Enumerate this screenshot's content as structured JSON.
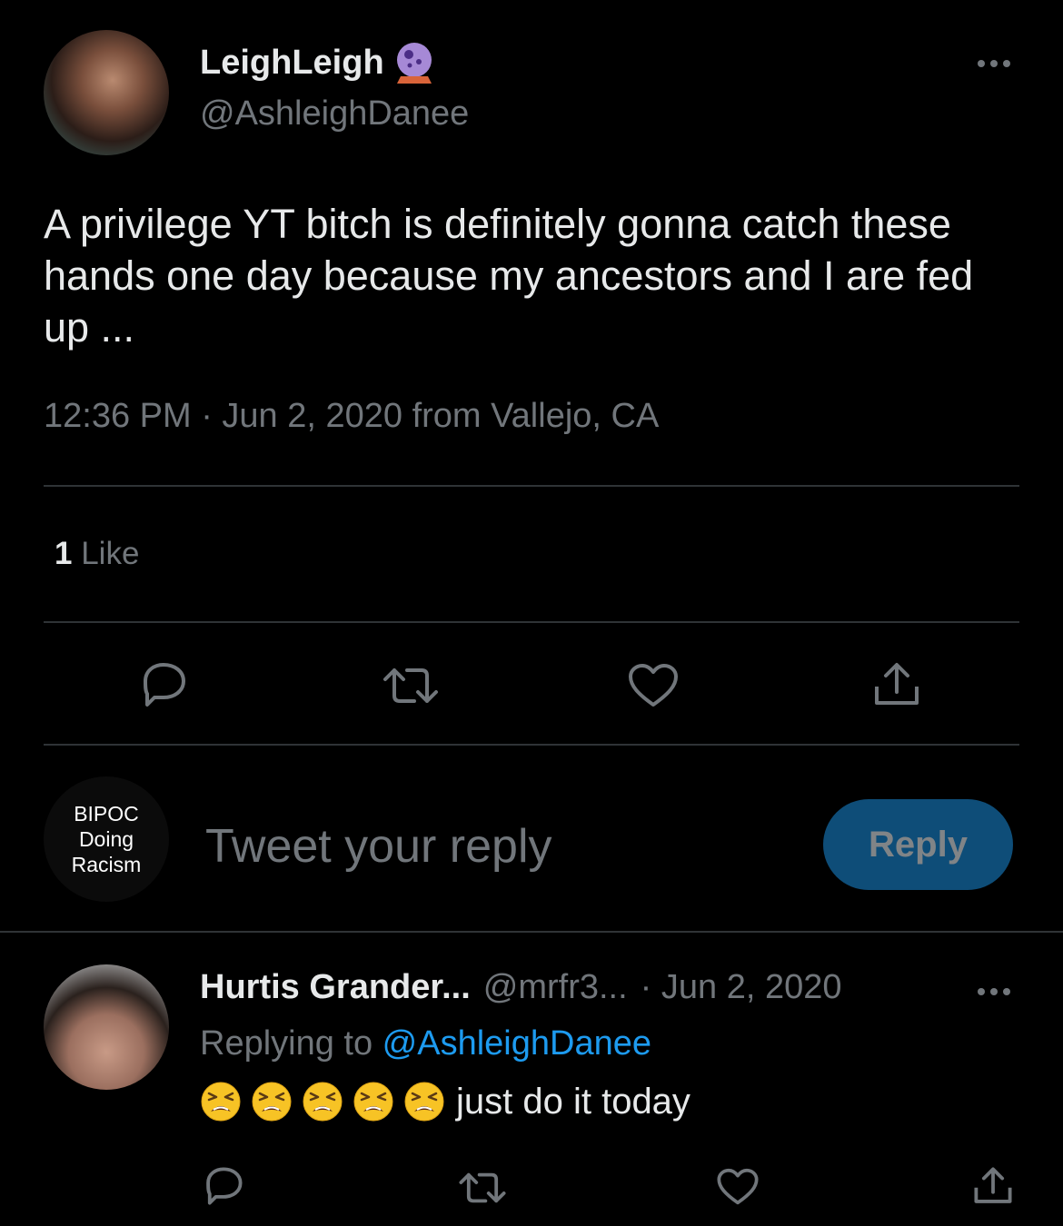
{
  "tweet": {
    "author_name": "LeighLeigh",
    "author_handle": "@AshleighDanee",
    "badge_icon": "crystal-ball-icon",
    "text": "A privilege YT bitch is definitely gonna catch these hands one day because my ancestors and I are fed up ...",
    "timestamp": "12:36 PM · Jun 2, 2020 from Vallejo, CA",
    "likes_count": "1",
    "likes_label": "Like"
  },
  "actions": {
    "icons": [
      "reply-icon",
      "retweet-icon",
      "like-icon",
      "share-icon"
    ]
  },
  "composer": {
    "avatar_text_lines": [
      "BIPOC",
      "Doing",
      "Racism"
    ],
    "placeholder": "Tweet your reply",
    "reply_button_label": "Reply",
    "reply_button_color": "#1d9bf0"
  },
  "reply_tweet": {
    "author_name": "Hurtis Grander...",
    "author_handle": "@mrfr3...",
    "date": "· Jun 2, 2020",
    "replying_prefix": "Replying to ",
    "replying_to": "@AshleighDanee",
    "emoji_name": "tired-face-emoji",
    "emoji_count": 5,
    "text": "just do it today"
  },
  "colors": {
    "background": "#000000",
    "text": "#e7e9ea",
    "muted": "#71767b",
    "link": "#1d9bf0",
    "divider": "#2f3336"
  }
}
